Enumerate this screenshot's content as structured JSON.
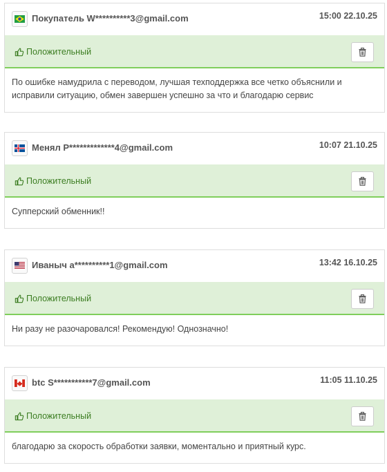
{
  "reviews": [
    {
      "flag": "brazil-flag-icon",
      "author": "Покупатель W**********3@gmail.com",
      "date": "15:00 22.10.25",
      "status": "Положительный",
      "text": "По ошибке намудрила с переводом, лучшая техподдержка все четко объяснили и исправили ситуацию, обмен завершен успешно за что и благодарю сервис"
    },
    {
      "flag": "iceland-flag-icon",
      "author": "Менял Р*************4@gmail.com",
      "date": "10:07 21.10.25",
      "status": "Положительный",
      "text": "Супперский обменник!!"
    },
    {
      "flag": "usa-flag-icon",
      "author": "Иваныч а**********1@gmail.com",
      "date": "13:42 16.10.25",
      "status": "Положительный",
      "text": "Ни разу не разочаровался! Рекомендую! Однозначно!"
    },
    {
      "flag": "canada-flag-icon",
      "author": "btc S***********7@gmail.com",
      "date": "11:05 11.10.25",
      "status": "Положительный",
      "text": "благодарю за скорость обработки заявки, моментально и приятный курс."
    }
  ],
  "colors": {
    "status_bg": "#dff0d8",
    "status_text": "#3c7d22",
    "status_border": "#7fce5b"
  }
}
